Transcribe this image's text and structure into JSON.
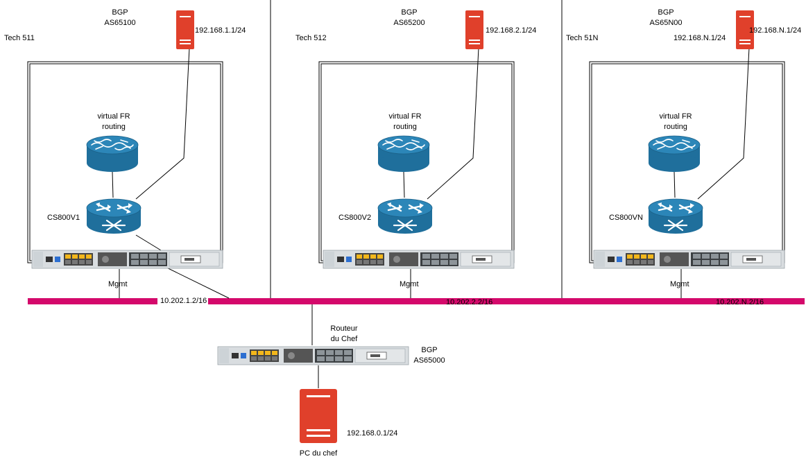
{
  "colors": {
    "router_blue": "#1f6f9c",
    "server_red": "#e0402b",
    "mgmt_bus": "#d4096b",
    "chassis": "#d9dde0"
  },
  "techs": [
    {
      "title": "Tech 511",
      "bgp_line1": "BGP",
      "bgp_line2": "AS65100",
      "server_ip": "192.168.1.1/24",
      "vfr_line1": "virtual FR",
      "vfr_line2": "routing",
      "router_name": "CS800V1",
      "mgmt_label": "Mgmt",
      "mgmt_ip": "10.202.1.2/16",
      "server_icon": "server-icon",
      "router_icon": "router-icon",
      "vfr_icon": "virtual-router-icon"
    },
    {
      "title": "Tech 512",
      "bgp_line1": "BGP",
      "bgp_line2": "AS65200",
      "server_ip": "192.168.2.1/24",
      "vfr_line1": "virtual FR",
      "vfr_line2": "routing",
      "router_name": "CS800V2",
      "mgmt_label": "Mgmt",
      "mgmt_ip": "10.202.2.2/16",
      "server_icon": "server-icon",
      "router_icon": "router-icon",
      "vfr_icon": "virtual-router-icon"
    },
    {
      "title": "Tech 51N",
      "bgp_line1": "BGP",
      "bgp_line2": "AS65N00",
      "server_ip": "192.168.N.1/24",
      "server_ip_alt": "192.168.N.1/24",
      "vfr_line1": "virtual FR",
      "vfr_line2": "routing",
      "router_name": "CS800VN",
      "mgmt_label": "Mgmt",
      "mgmt_ip": "10.202.N.2/16",
      "server_icon": "server-icon",
      "router_icon": "router-icon",
      "vfr_icon": "virtual-router-icon"
    }
  ],
  "chef": {
    "router_line1": "Routeur",
    "router_line2": "du Chef",
    "bgp_line1": "BGP",
    "bgp_line2": "AS65000",
    "pc_ip": "192.168.0.1/24",
    "pc_label": "PC du chef",
    "pc_icon": "server-icon"
  }
}
